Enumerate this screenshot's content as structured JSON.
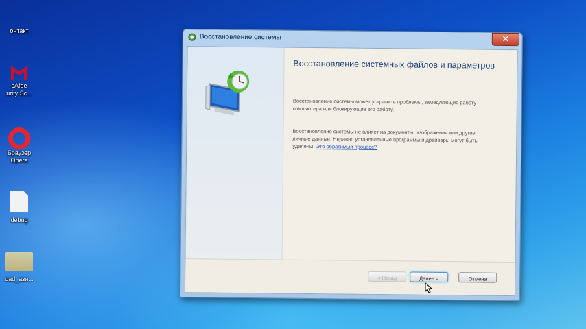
{
  "desktop": {
    "icons": [
      {
        "label": "онтакт"
      },
      {
        "label": "cAfee\nurity Sc..."
      },
      {
        "label": "Браузер\nOpera"
      },
      {
        "label": "debug"
      },
      {
        "label": "oad_ази..."
      }
    ]
  },
  "window": {
    "title": "Восстановление системы",
    "close_symbol": "✕",
    "heading": "Восстановление системных файлов и параметров",
    "paragraph1": "Восстановление системы может устранить проблемы, замедляющие работу компьютера или блокирующие его работу.",
    "paragraph2": "Восстановление системы не влияет на документы, изображения или другие личные данные. Недавно установленные программы и драйверы могут быть удалены.",
    "paragraph2_link": "Это обратимый процесс?",
    "buttons": {
      "back": "< Назад",
      "next": "Далее >",
      "cancel": "Отмена"
    }
  },
  "colors": {
    "heading": "#1b3e7a",
    "link": "#2a56b8",
    "close_button": "#c2402a"
  }
}
